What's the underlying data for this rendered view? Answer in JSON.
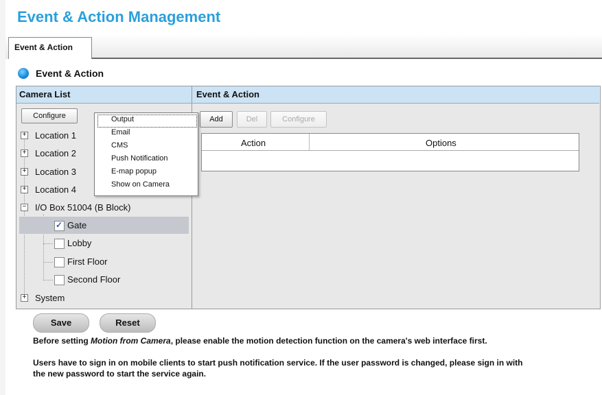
{
  "header": {
    "title": "Event & Action Management"
  },
  "tabs": [
    {
      "label": "Event & Action"
    }
  ],
  "section": {
    "title": "Event & Action"
  },
  "camera_list": {
    "header": "Camera List",
    "configure_label": "Configure",
    "tree": {
      "locations": [
        "Location 1",
        "Location 2",
        "Location 3",
        "Location 4"
      ],
      "io_box": "I/O Box 51004 (B Block)",
      "io_children": [
        {
          "label": "Gate",
          "checked": true
        },
        {
          "label": "Lobby",
          "checked": false
        },
        {
          "label": "First Floor",
          "checked": false
        },
        {
          "label": "Second Floor",
          "checked": false
        }
      ],
      "system": "System"
    }
  },
  "dropdown": {
    "items": [
      "Output",
      "Email",
      "CMS",
      "Push Notification",
      "E-map popup",
      "Show on Camera"
    ]
  },
  "event_action": {
    "header": "Event & Action",
    "add_label": "Add",
    "del_label": "Del",
    "configure_label": "Configure",
    "columns": [
      "Action",
      "Options"
    ]
  },
  "footer": {
    "save_label": "Save",
    "reset_label": "Reset",
    "note1_pre": "Before setting ",
    "note1_em": "Motion from Camera",
    "note1_post": ", please enable the motion detection function on the camera's web interface first.",
    "note2_line1": "Users have to sign in on mobile clients to start push notification service. If the user password is changed, please sign in with",
    "note2_line2": "the new password to start the service again."
  },
  "colors": {
    "title": "#2aa0dc",
    "header_bg": "#cce3f5",
    "selected_row": "#c5c8ce"
  }
}
